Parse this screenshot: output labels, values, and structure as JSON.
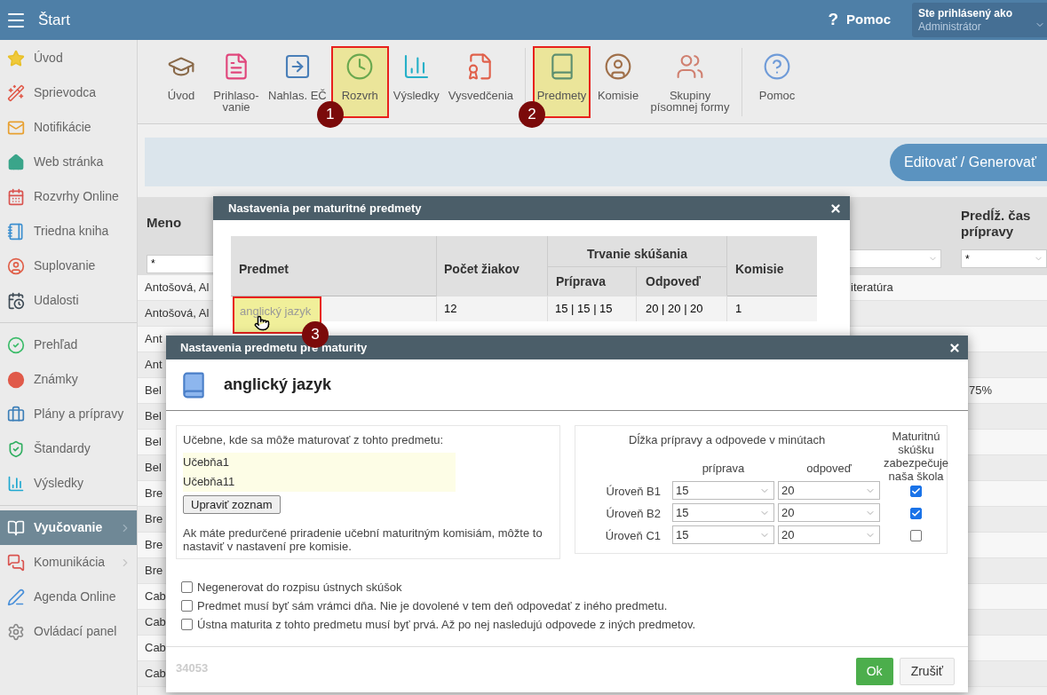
{
  "header": {
    "title": "Štart",
    "help_glyph": "?",
    "help": "Pomoc",
    "user_label": "Ste prihlásený ako",
    "user_role": "Administrátor"
  },
  "sidebar": {
    "groups": [
      {
        "items": [
          {
            "label": "Úvod",
            "selected": false,
            "submenu": false
          },
          {
            "label": "Sprievodca",
            "selected": false,
            "submenu": false
          },
          {
            "label": "Notifikácie",
            "selected": false,
            "submenu": false
          },
          {
            "label": "Web stránka",
            "selected": false,
            "submenu": false
          },
          {
            "label": "Rozvrhy Online",
            "selected": false,
            "submenu": false
          },
          {
            "label": "Triedna kniha",
            "selected": false,
            "submenu": false
          },
          {
            "label": "Suplovanie",
            "selected": false,
            "submenu": false
          },
          {
            "label": "Udalosti",
            "selected": false,
            "submenu": false
          }
        ]
      },
      {
        "items": [
          {
            "label": "Prehľad",
            "selected": false,
            "submenu": false
          },
          {
            "label": "Známky",
            "selected": false,
            "submenu": false
          },
          {
            "label": "Plány a prípravy",
            "selected": false,
            "submenu": false
          },
          {
            "label": "Štandardy",
            "selected": false,
            "submenu": false
          },
          {
            "label": "Výsledky",
            "selected": false,
            "submenu": false
          }
        ]
      },
      {
        "items": [
          {
            "label": "Vyučovanie",
            "selected": true,
            "submenu": true
          },
          {
            "label": "Komunikácia",
            "selected": false,
            "submenu": true
          },
          {
            "label": "Agenda Online",
            "selected": false,
            "submenu": false
          },
          {
            "label": "Ovládací panel",
            "selected": false,
            "submenu": false
          }
        ]
      }
    ]
  },
  "toolbar": {
    "groups": [
      {
        "items": [
          {
            "label": "Úvod",
            "highlighted": false
          },
          {
            "label": "Prihlaso-vanie",
            "highlighted": false
          },
          {
            "label": "Nahlas. EČ",
            "highlighted": false
          },
          {
            "label": "Rozvrh",
            "highlighted": true,
            "badge": "1"
          },
          {
            "label": "Výsledky",
            "highlighted": false
          },
          {
            "label": "Vysvedčenia",
            "highlighted": false
          }
        ]
      },
      {
        "items": [
          {
            "label": "Predmety",
            "highlighted": true,
            "badge": "2"
          },
          {
            "label": "Komisie",
            "highlighted": false
          },
          {
            "label": "Skupiny písomnej formy",
            "highlighted": false
          }
        ]
      },
      {
        "items": [
          {
            "label": "Pomoc",
            "highlighted": false
          }
        ]
      }
    ]
  },
  "action_button": "Editovať / Generovať",
  "table": {
    "columns": [
      {
        "label": "Meno",
        "filter": "*"
      },
      {
        "label": "Predĺž. čas prípravy",
        "filter": "*"
      }
    ],
    "rows": [
      {
        "name": "Antošová, Al",
        "column_3": "iteratúra"
      },
      {
        "name": "Antošová, Al"
      },
      {
        "name": "Ant"
      },
      {
        "name": "Ant"
      },
      {
        "name": "Bel",
        "extended_prep": "75%"
      },
      {
        "name": "Bel"
      },
      {
        "name": "Bel"
      },
      {
        "name": "Bel"
      },
      {
        "name": "Bre"
      },
      {
        "name": "Bre"
      },
      {
        "name": "Bre"
      },
      {
        "name": "Bre"
      },
      {
        "name": "Cab"
      },
      {
        "name": "Cab"
      },
      {
        "name": "Cab"
      },
      {
        "name": "Cab"
      }
    ]
  },
  "subjects_dialog": {
    "title": "Nastavenia per maturitné predmety",
    "columns": {
      "subject": "Predmet",
      "students": "Počet žiakov",
      "duration": "Trvanie skúšania",
      "preparation": "Príprava",
      "answer": "Odpoveď",
      "committee": "Komisie"
    },
    "rows": [
      {
        "subject": "anglický jazyk",
        "students": "12",
        "preparation": "15 | 15 | 15",
        "answer": "20 | 20 | 20",
        "committee": "1",
        "highlighted": true,
        "badge": "3"
      }
    ]
  },
  "subject_dialog": {
    "title": "Nastavenia predmetu pre maturity",
    "subject": "anglický jazyk",
    "rooms_label": "Učebne, kde sa môže maturovať z tohto predmetu:",
    "rooms": [
      "Učebňa1",
      "Učebňa11"
    ],
    "edit_button": "Upraviť zoznam",
    "rooms_note": "Ak máte predurčené priradenie učební maturitným komisiám, môžte to nastaviť v nastavení pre komisie.",
    "duration_heading": "Dĺžka prípravy a odpovede v minútach",
    "school_heading": "Maturitnú skúšku zabezpečuje naša škola",
    "prep_heading": "príprava",
    "answer_heading": "odpoveď",
    "levels": [
      {
        "label": "Úroveň B1",
        "preparation": "15",
        "answer": "20",
        "checked": true
      },
      {
        "label": "Úroveň B2",
        "preparation": "15",
        "answer": "20",
        "checked": true
      },
      {
        "label": "Úroveň C1",
        "preparation": "15",
        "answer": "20",
        "checked": false
      }
    ],
    "options": [
      {
        "label": "Negenerovat do rozpisu ústnych skúšok",
        "checked": false
      },
      {
        "label": "Predmet musí byť sám vrámci dňa. Nie je dovolené v tem deň odpovedať z iného predmetu.",
        "checked": false
      },
      {
        "label": "Ústna maturita z tohto predmetu musí byť prvá. Až po nej nasledujú odpovede z iných predmetov.",
        "checked": false
      }
    ],
    "id": "34053",
    "ok": "Ok",
    "cancel": "Zrušiť"
  }
}
